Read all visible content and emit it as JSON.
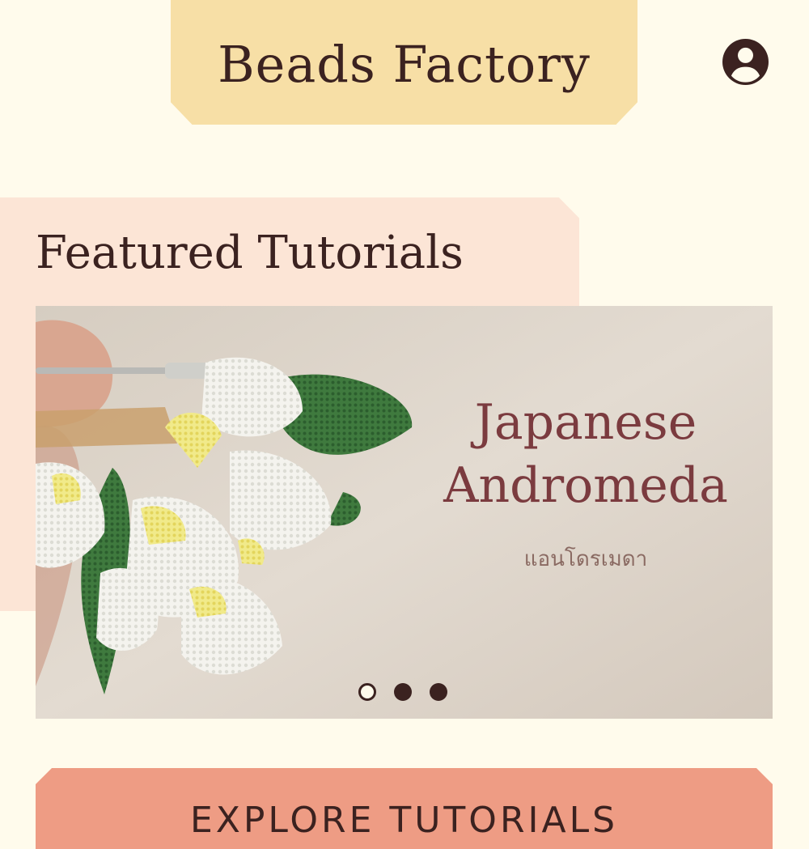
{
  "header": {
    "app_title": "Beads Factory",
    "profile_icon": "account-circle-icon"
  },
  "featured": {
    "section_title": "Featured Tutorials",
    "slides": [
      {
        "heading_line1": "Japanese",
        "heading_line2": "Andromeda",
        "subtitle": "แอนโดรเมดา",
        "image": "beaded-lily-of-the-valley-flower-brooch"
      }
    ],
    "active_slide_index": 0,
    "slide_count": 3
  },
  "actions": {
    "explore_label": "EXPLORE TUTORIALS"
  },
  "colors": {
    "background": "#fffbec",
    "title_banner": "#f7dfa6",
    "featured_panel": "#fce5d6",
    "primary_button": "#ee9c84",
    "text": "#3b2220",
    "slide_heading": "#7b3b3f"
  }
}
